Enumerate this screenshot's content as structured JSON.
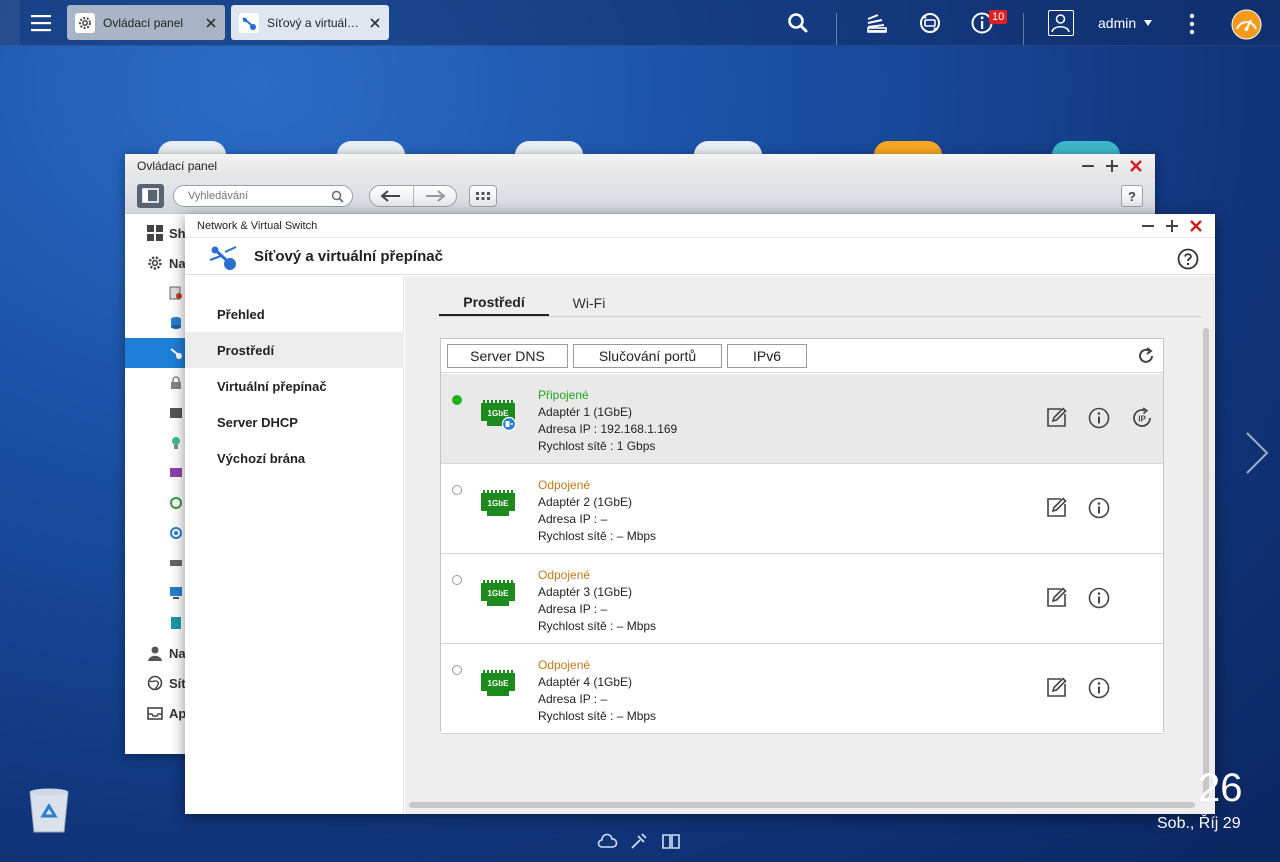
{
  "topbar": {
    "tabs": [
      {
        "label": "Ovládací panel"
      },
      {
        "label": "Síťový a virtuální přepínač"
      }
    ],
    "notification_count": "10",
    "user": "admin"
  },
  "control_panel": {
    "title": "Ovládací panel",
    "search_placeholder": "Vyhledávání",
    "side_items": [
      "Sh",
      "Na",
      "Na",
      "Síť",
      "Ap"
    ]
  },
  "network_window": {
    "titlebar": "Network & Virtual Switch",
    "heading": "Síťový a virtuální přepínač",
    "menu": [
      {
        "label": "Přehled"
      },
      {
        "label": "Prostředí"
      },
      {
        "label": "Virtuální přepínač"
      },
      {
        "label": "Server DHCP"
      },
      {
        "label": "Výchozí brána"
      }
    ],
    "subtabs": [
      "Prostředí",
      "Wi-Fi"
    ],
    "toolbar_buttons": [
      "Server DNS",
      "Slučování portů",
      "IPv6"
    ],
    "adapters": [
      {
        "status": "Připojené",
        "name": "Adaptér 1 (1GbE)",
        "ip": "Adresa IP : 192.168.1.169",
        "speed": "Rychlost sítě : 1 Gbps",
        "nic_label": "1GbE"
      },
      {
        "status": "Odpojené",
        "name": "Adaptér 2 (1GbE)",
        "ip": "Adresa IP : –",
        "speed": "Rychlost sítě : – Mbps",
        "nic_label": "1GbE"
      },
      {
        "status": "Odpojené",
        "name": "Adaptér 3 (1GbE)",
        "ip": "Adresa IP : –",
        "speed": "Rychlost sítě : – Mbps",
        "nic_label": "1GbE"
      },
      {
        "status": "Odpojené",
        "name": "Adaptér 4 (1GbE)",
        "ip": "Adresa IP : –",
        "speed": "Rychlost sítě : – Mbps",
        "nic_label": "1GbE"
      }
    ]
  },
  "desktop": {
    "clock_digits": "26",
    "date": "Sob., Říj 29"
  },
  "colors": {
    "accent_blue": "#1e7fd8",
    "connected_green": "#1ea51e",
    "disconnected_orange": "#c07a1a",
    "nic_green": "#1c8a1c",
    "close_red": "#d01c1c",
    "badge_red": "#e02020"
  }
}
